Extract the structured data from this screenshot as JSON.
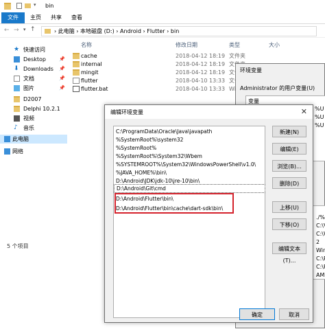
{
  "explorer": {
    "title": "bin",
    "tabs": [
      "文件",
      "主页",
      "共享",
      "查看"
    ],
    "address": [
      "此电脑",
      "本地磁盘 (D:)",
      "Android",
      "Flutter",
      "bin"
    ],
    "columns": {
      "name": "名称",
      "date": "修改日期",
      "type": "类型",
      "size": "大小"
    },
    "nav": [
      {
        "label": "快速访问",
        "icon": "star-icon"
      },
      {
        "label": "Desktop",
        "icon": "desktop-icon"
      },
      {
        "label": "Downloads",
        "icon": "download-icon"
      },
      {
        "label": "文档",
        "icon": "document-icon"
      },
      {
        "label": "图片",
        "icon": "picture-icon"
      },
      {
        "label": "D2007",
        "icon": "folder-icon"
      },
      {
        "label": "Delphi 10.2.1",
        "icon": "folder-icon"
      },
      {
        "label": "视频",
        "icon": "video-icon"
      },
      {
        "label": "音乐",
        "icon": "music-icon"
      },
      {
        "label": "此电脑",
        "icon": "computer-icon"
      },
      {
        "label": "网络",
        "icon": "network-icon"
      }
    ],
    "files": [
      {
        "name": "cache",
        "date": "2018-04-12 18:19",
        "type": "文件夹",
        "kind": "folder"
      },
      {
        "name": "internal",
        "date": "2018-04-12 18:19",
        "type": "文件夹",
        "kind": "folder"
      },
      {
        "name": "mingit",
        "date": "2018-04-12 18:19",
        "type": "文件夹",
        "kind": "folder"
      },
      {
        "name": "flutter",
        "date": "2018-04-10 13:33",
        "type": "文件",
        "kind": "file"
      },
      {
        "name": "flutter.bat",
        "date": "2018-04-10 13:33",
        "type": "Windo",
        "kind": "file"
      }
    ],
    "status": "5 个项目"
  },
  "env_dialog": {
    "title": "环境变量",
    "user_group": "Administrator 的用户变量(U)",
    "col_var": "变量",
    "top_values": [
      "%U",
      "%U",
      "%U"
    ],
    "bottom_values": [
      "./%.",
      "C:\\V",
      "C:\\W",
      "2",
      "Wind",
      "C:\\P",
      "C:\\P",
      "AMD"
    ]
  },
  "edit_dialog": {
    "title": "编辑环境变量",
    "paths": [
      "C:\\ProgramData\\Oracle\\Java\\javapath",
      "%SystemRoot%\\system32",
      "%SystemRoot%",
      "%SystemRoot%\\System32\\Wbem",
      "%SYSTEMROOT%\\System32\\WindowsPowerShell\\v1.0\\",
      "%JAVA_HOME%\\bin\\",
      "D:\\Android\\JDK\\jdk-10\\jre-10\\bin\\",
      "D:\\Android\\Git\\cmd",
      "D:\\Android\\Flutter\\bin\\",
      "D:\\Android\\Flutter\\bin\\cache\\dart-sdk\\bin\\"
    ],
    "buttons": {
      "new": "新建(N)",
      "edit": "编辑(E)",
      "browse": "浏览(B)...",
      "delete": "删除(D)",
      "up": "上移(U)",
      "down": "下移(O)",
      "edit_text": "编辑文本(T)...",
      "ok": "确定",
      "cancel": "取消"
    },
    "close": "✕"
  }
}
